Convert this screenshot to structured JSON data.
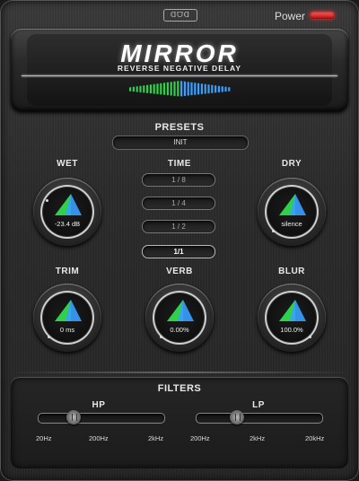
{
  "header": {
    "brand": "ᗡᗜᗡ",
    "power_label": "Power"
  },
  "display": {
    "title": "MIRROR",
    "subtitle": "REVERSE NEGATIVE DELAY"
  },
  "presets": {
    "label": "PRESETS",
    "current": "INIT"
  },
  "time": {
    "label": "TIME",
    "options": [
      "1 / 8",
      "1 / 4",
      "1 / 2",
      "1/1"
    ],
    "selected": "1/1"
  },
  "knobs": {
    "wet": {
      "label": "WET",
      "value": "-23.4 dB"
    },
    "dry": {
      "label": "DRY",
      "value": "silence"
    },
    "trim": {
      "label": "TRIM",
      "value": "0 ms"
    },
    "verb": {
      "label": "VERB",
      "value": "0.00%"
    },
    "blur": {
      "label": "BLUR",
      "value": "100.0%"
    }
  },
  "filters": {
    "label": "FILTERS",
    "hp": {
      "label": "HP",
      "ticks": [
        "20Hz",
        "200Hz",
        "2kHz"
      ],
      "position": 0.25
    },
    "lp": {
      "label": "LP",
      "ticks": [
        "200Hz",
        "2kHz",
        "20kHz"
      ],
      "position": 0.3
    }
  },
  "colors": {
    "accent_green": "#2fd04a",
    "accent_blue": "#3aa0ff",
    "power_led": "#e02020"
  }
}
